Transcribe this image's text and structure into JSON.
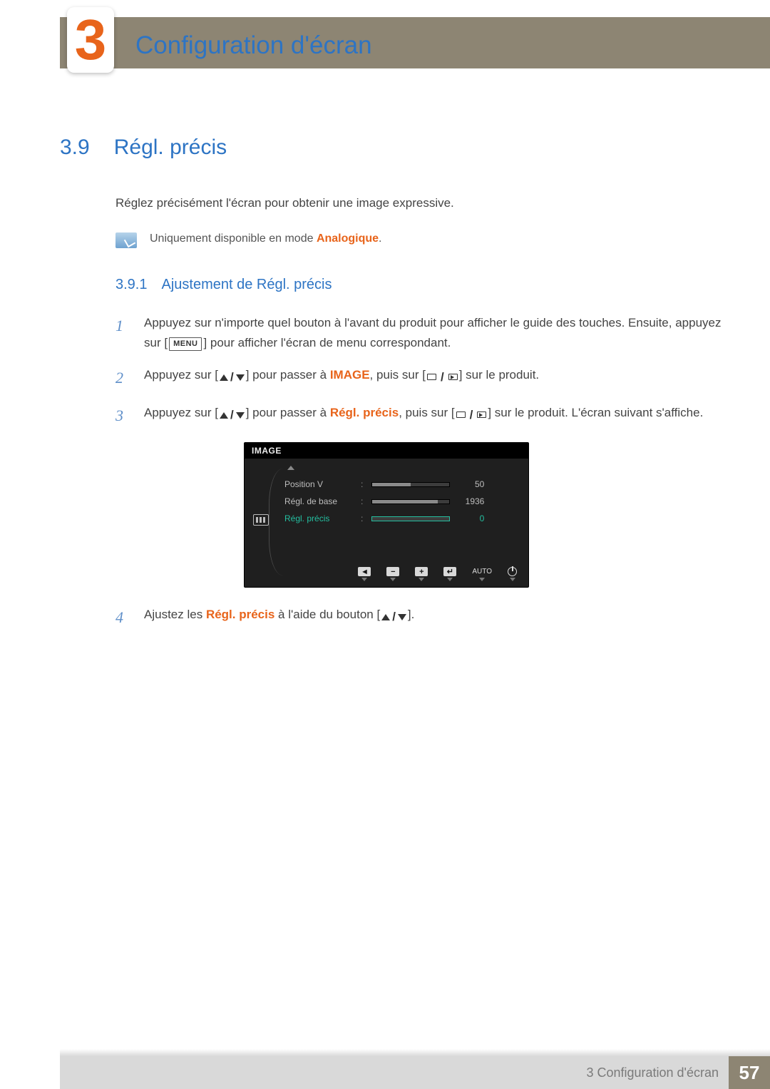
{
  "header": {
    "chapter_number": "3",
    "chapter_title": "Configuration d'écran"
  },
  "section": {
    "number": "3.9",
    "title": "Régl. précis",
    "intro": "Réglez précisément l'écran pour obtenir une image expressive.",
    "note_prefix": "Uniquement disponible en mode ",
    "note_highlight": "Analogique",
    "note_suffix": "."
  },
  "subsection": {
    "number": "3.9.1",
    "title": "Ajustement de Régl. précis"
  },
  "steps": {
    "s1_a": "Appuyez sur n'importe quel bouton à l'avant du produit pour afficher le guide des touches. Ensuite, appuyez sur [",
    "s1_menu": "MENU",
    "s1_b": "] pour afficher l'écran de menu correspondant.",
    "s2_a": "Appuyez sur [",
    "s2_b": "] pour passer à ",
    "s2_hl": "IMAGE",
    "s2_c": ", puis sur [",
    "s2_d": "] sur le produit.",
    "s3_a": "Appuyez sur [",
    "s3_b": "] pour passer à ",
    "s3_hl": "Régl. précis",
    "s3_c": ", puis sur [",
    "s3_d": "] sur le produit. L'écran suivant s'affiche.",
    "s4_a": "Ajustez les ",
    "s4_hl": "Régl. précis",
    "s4_b": " à l'aide du bouton [",
    "s4_c": "]."
  },
  "step_numbers": {
    "n1": "1",
    "n2": "2",
    "n3": "3",
    "n4": "4"
  },
  "osd": {
    "title": "IMAGE",
    "rows": [
      {
        "label": "Position V",
        "value": "50",
        "fill_pct": 50,
        "active": false
      },
      {
        "label": "Régl. de base",
        "value": "1936",
        "fill_pct": 85,
        "active": false
      },
      {
        "label": "Régl. précis",
        "value": "0",
        "fill_pct": 0,
        "active": true
      }
    ],
    "buttons": [
      "◄",
      "−",
      "+",
      "↵",
      "AUTO",
      "⏻"
    ]
  },
  "footer": {
    "text": "3 Configuration d'écran",
    "page": "57"
  }
}
